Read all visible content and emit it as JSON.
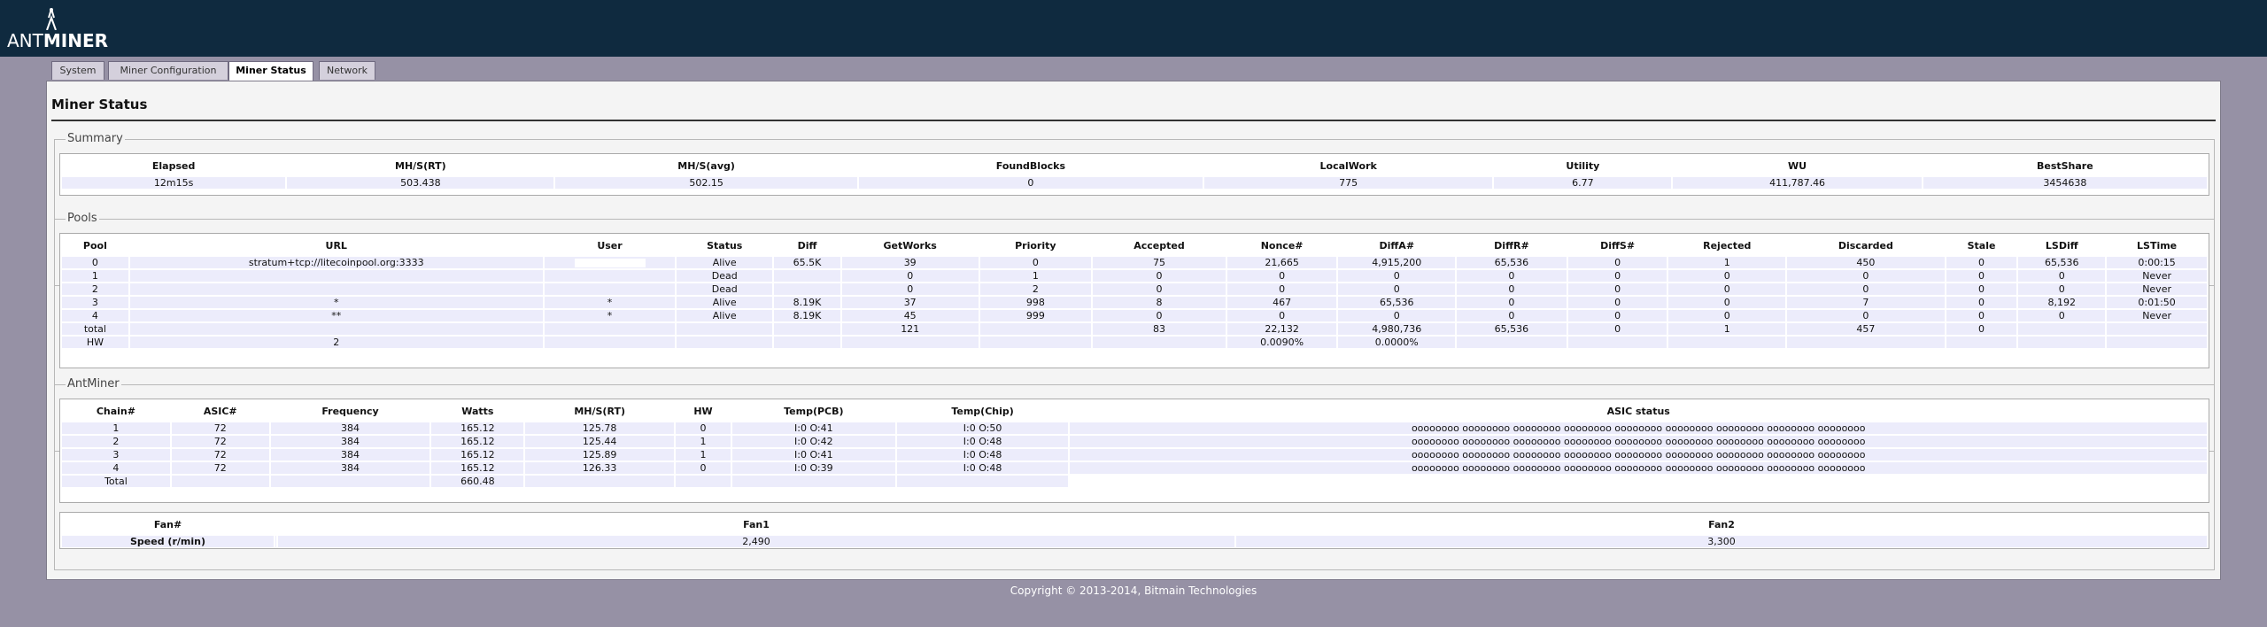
{
  "brand": {
    "logo_text_light": "ANT",
    "logo_text_bold": "MINER"
  },
  "tabs": [
    {
      "label": "System"
    },
    {
      "label": "Miner Configuration"
    },
    {
      "label": "Miner Status"
    },
    {
      "label": "Network"
    }
  ],
  "page_title": "Miner Status",
  "summary": {
    "legend": "Summary",
    "headers": [
      "Elapsed",
      "MH/S(RT)",
      "MH/S(avg)",
      "FoundBlocks",
      "LocalWork",
      "Utility",
      "WU",
      "BestShare"
    ],
    "rows": [
      [
        "12m15s",
        "503.438",
        "502.15",
        "0",
        "775",
        "6.77",
        "411,787.46",
        "3454638"
      ]
    ]
  },
  "pools": {
    "legend": "Pools",
    "headers": [
      "Pool",
      "URL",
      "User",
      "Status",
      "Diff",
      "GetWorks",
      "Priority",
      "Accepted",
      "Nonce#",
      "DiffA#",
      "DiffR#",
      "DiffS#",
      "Rejected",
      "Discarded",
      "Stale",
      "LSDiff",
      "LSTime"
    ],
    "rows": [
      [
        "0",
        "stratum+tcp://litecoinpool.org:3333",
        "",
        "Alive",
        "65.5K",
        "39",
        "0",
        "75",
        "21,665",
        "4,915,200",
        "65,536",
        "0",
        "1",
        "450",
        "0",
        "65,536",
        "0:00:15"
      ],
      [
        "1",
        "",
        "",
        "Dead",
        "",
        "0",
        "1",
        "0",
        "0",
        "0",
        "0",
        "0",
        "0",
        "0",
        "0",
        "0",
        "Never"
      ],
      [
        "2",
        "",
        "",
        "Dead",
        "",
        "0",
        "2",
        "0",
        "0",
        "0",
        "0",
        "0",
        "0",
        "0",
        "0",
        "0",
        "Never"
      ],
      [
        "3",
        "*",
        "*",
        "Alive",
        "8.19K",
        "37",
        "998",
        "8",
        "467",
        "65,536",
        "0",
        "0",
        "0",
        "7",
        "0",
        "8,192",
        "0:01:50"
      ],
      [
        "4",
        "**",
        "*",
        "Alive",
        "8.19K",
        "45",
        "999",
        "0",
        "0",
        "0",
        "0",
        "0",
        "0",
        "0",
        "0",
        "0",
        "Never"
      ],
      [
        "total",
        "",
        "",
        "",
        "",
        "121",
        "",
        "83",
        "22,132",
        "4,980,736",
        "65,536",
        "0",
        "1",
        "457",
        "0",
        "",
        ""
      ],
      [
        "HW",
        "2",
        "",
        "",
        "",
        "",
        "",
        "",
        "0.0090%",
        "0.0000%",
        "",
        "",
        "",
        "",
        "",
        "",
        ""
      ]
    ]
  },
  "antminer": {
    "legend": "AntMiner",
    "headers": [
      "Chain#",
      "ASIC#",
      "Frequency",
      "Watts",
      "MH/S(RT)",
      "HW",
      "Temp(PCB)",
      "Temp(Chip)",
      "ASIC status"
    ],
    "rows": [
      [
        "1",
        "72",
        "384",
        "165.12",
        "125.78",
        "0",
        "I:0 O:41",
        "I:0 O:50",
        "oooooooo oooooooo oooooooo oooooooo oooooooo oooooooo oooooooo oooooooo oooooooo"
      ],
      [
        "2",
        "72",
        "384",
        "165.12",
        "125.44",
        "1",
        "I:0 O:42",
        "I:0 O:48",
        "oooooooo oooooooo oooooooo oooooooo oooooooo oooooooo oooooooo oooooooo oooooooo"
      ],
      [
        "3",
        "72",
        "384",
        "165.12",
        "125.89",
        "1",
        "I:0 O:41",
        "I:0 O:48",
        "oooooooo oooooooo oooooooo oooooooo oooooooo oooooooo oooooooo oooooooo oooooooo"
      ],
      [
        "4",
        "72",
        "384",
        "165.12",
        "126.33",
        "0",
        "I:0 O:39",
        "I:0 O:48",
        "oooooooo oooooooo oooooooo oooooooo oooooooo oooooooo oooooooo oooooooo oooooooo"
      ],
      [
        "Total",
        "",
        "",
        "660.48",
        "",
        "",
        "",
        "",
        ""
      ]
    ],
    "fan_headers": [
      "Fan#",
      "",
      "Fan1",
      "Fan2"
    ],
    "fan_rows": [
      [
        "Speed (r/min)",
        "",
        "2,490",
        "3,300"
      ]
    ]
  },
  "copyright": "Copyright © 2013-2014, Bitmain Technologies"
}
